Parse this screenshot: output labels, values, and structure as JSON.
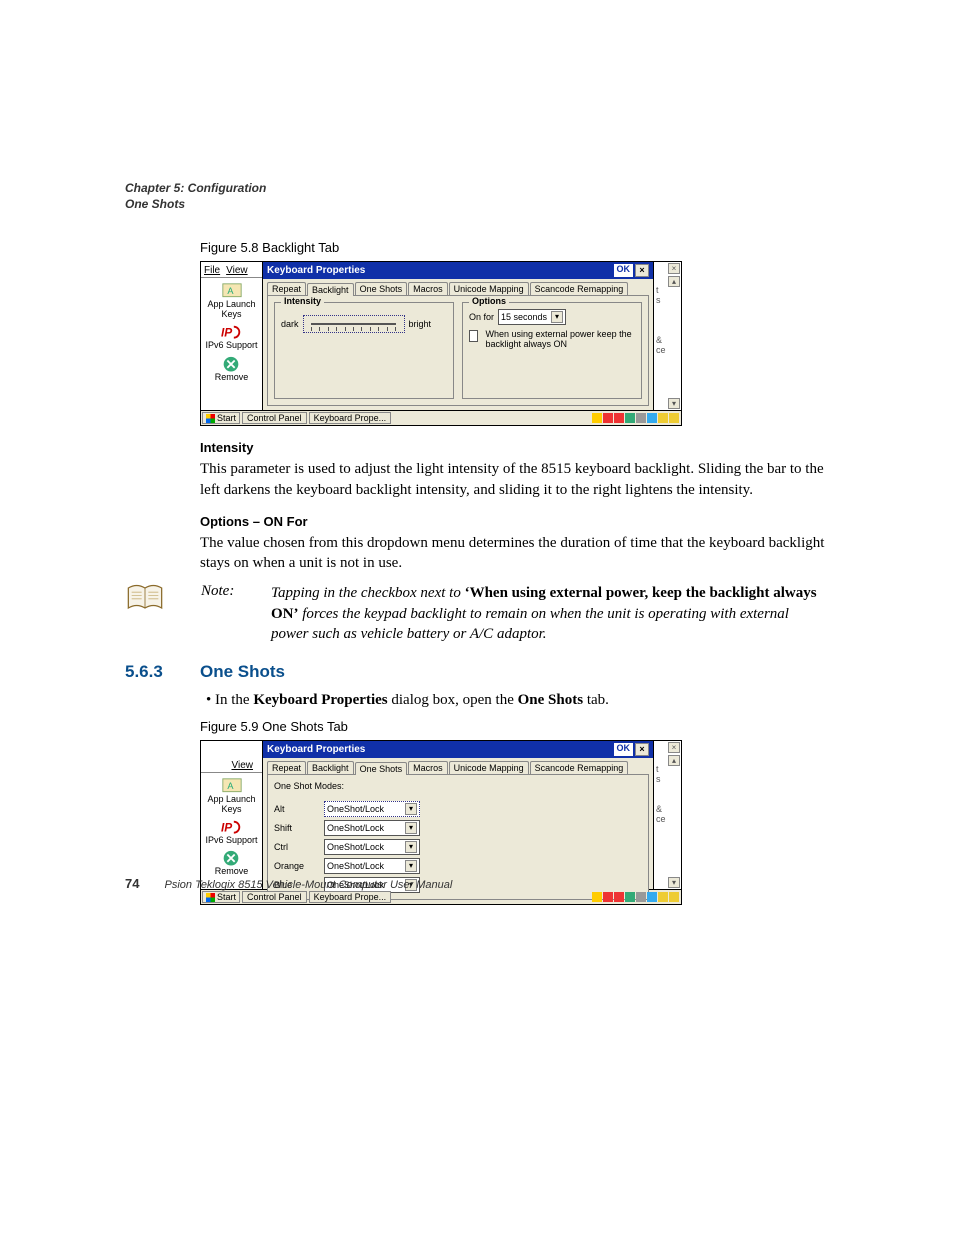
{
  "header": {
    "chapter": "Chapter 5: Configuration",
    "section": "One Shots"
  },
  "fig58": {
    "caption": "Figure 5.8  Backlight Tab",
    "menu_file": "File",
    "menu_view": "View",
    "title": "Keyboard Properties",
    "ok": "OK",
    "tabs": [
      "Repeat",
      "Backlight",
      "One Shots",
      "Macros",
      "Unicode Mapping",
      "Scancode Remapping"
    ],
    "intensity_legend": "Intensity",
    "dark": "dark",
    "bright": "bright",
    "options_legend": "Options",
    "on_for": "On for",
    "on_for_value": "15 seconds",
    "ext_power": "When using external power keep the backlight always ON",
    "desktop": {
      "app": "App Launch Keys",
      "ipv6": "IPv6 Support",
      "remove": "Remove"
    },
    "taskbar": {
      "start": "Start",
      "cp": "Control Panel",
      "kp": "Keyboard Prope..."
    }
  },
  "intensity": {
    "h": "Intensity",
    "p": "This parameter is used to adjust the light intensity of the 8515 keyboard backlight. Sliding the bar to the left darkens the keyboard backlight intensity, and sliding it to the right lightens the intensity."
  },
  "onfor": {
    "h": "Options – ON For",
    "p": "The value chosen from this dropdown menu determines the duration of time that the keyboard backlight stays on when a unit is not in use."
  },
  "note": {
    "label": "Note:",
    "lead": "Tapping in the checkbox next to ",
    "bold": "‘When using external power, keep the backlight always ON’",
    "tail": " forces the keypad backlight to remain on when the unit is operating with external power such as vehicle battery or A/C adaptor."
  },
  "sec": {
    "num": "5.6.3",
    "title": "One Shots"
  },
  "bullet": {
    "pre": "In the ",
    "b1": "Keyboard Properties",
    "mid": " dialog box, open the ",
    "b2": "One Shots",
    "post": " tab."
  },
  "fig59": {
    "caption": "Figure 5.9  One Shots Tab",
    "menu_view": "View",
    "title": "Keyboard Properties",
    "ok": "OK",
    "tabs": [
      "Repeat",
      "Backlight",
      "One Shots",
      "Macros",
      "Unicode Mapping",
      "Scancode Remapping"
    ],
    "modes_label": "One Shot Modes:",
    "rows": [
      {
        "k": "Alt",
        "v": "OneShot/Lock"
      },
      {
        "k": "Shift",
        "v": "OneShot/Lock"
      },
      {
        "k": "Ctrl",
        "v": "OneShot/Lock"
      },
      {
        "k": "Orange",
        "v": "OneShot/Lock"
      },
      {
        "k": "Blue",
        "v": "OneShot/Lock"
      }
    ],
    "desktop": {
      "app": "App Launch Keys",
      "ipv6": "IPv6 Support",
      "remove": "Remove"
    },
    "taskbar": {
      "start": "Start",
      "cp": "Control Panel",
      "kp": "Keyboard Prope..."
    }
  },
  "footer": {
    "page": "74",
    "text": "Psion Teklogix 8515 Vehicle-Mount Computer User Manual"
  }
}
